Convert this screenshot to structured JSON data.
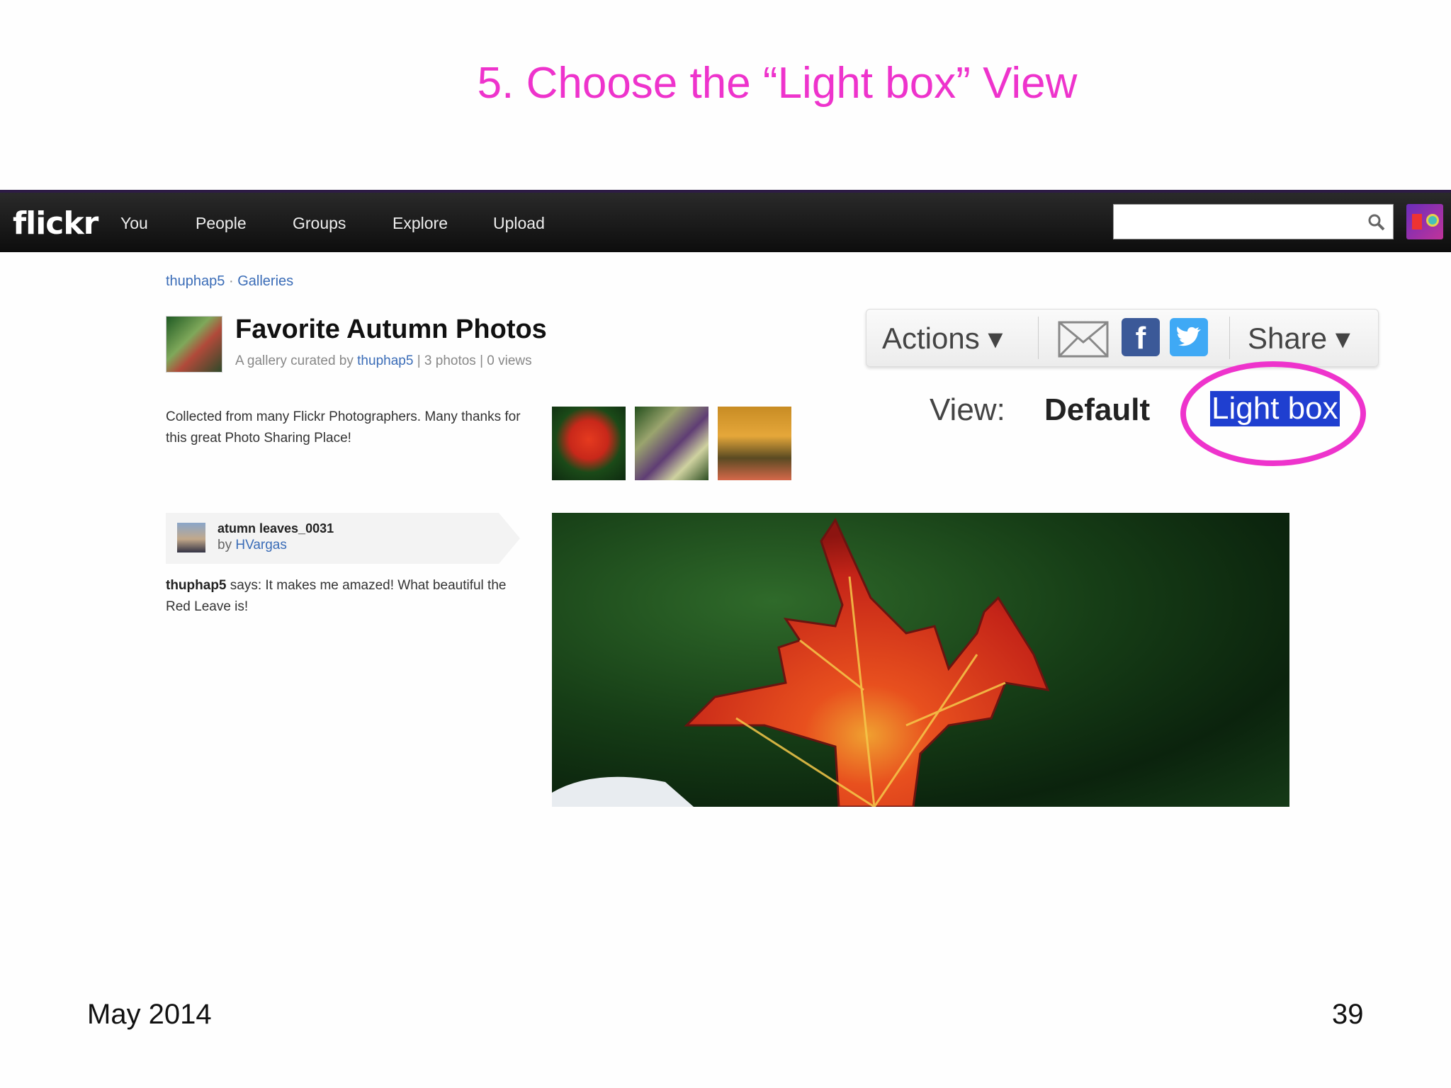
{
  "slide": {
    "title": "5. Choose the “Light box” View",
    "footer_date": "May 2014",
    "page_number": "39"
  },
  "nav": {
    "logo": "flickr",
    "items": [
      "You",
      "People",
      "Groups",
      "Explore",
      "Upload"
    ],
    "search_placeholder": ""
  },
  "breadcrumb": {
    "user": "thuphap5",
    "separator": "·",
    "section": "Galleries"
  },
  "gallery": {
    "title": "Favorite Autumn Photos",
    "meta_prefix": "A gallery curated by",
    "curator": "thuphap5",
    "meta_suffix": "| 3 photos | 0 views",
    "description": "Collected from many Flickr Photographers. Many thanks for this great Photo Sharing Place!"
  },
  "actions": {
    "actions_label": "Actions ▾",
    "share_label": "Share ▾"
  },
  "view": {
    "label": "View:",
    "default": "Default",
    "lightbox": "Light box"
  },
  "comment": {
    "photo_title": "atumn leaves_0031",
    "by_prefix": "by",
    "author": "HVargas",
    "commenter": "thuphap5",
    "text": "says: It makes me amazed! What beautiful the Red Leave is!"
  },
  "colors": {
    "accent_pink": "#ee33cc",
    "link_blue": "#3a6cb7",
    "selection_blue": "#1f3fd0"
  }
}
